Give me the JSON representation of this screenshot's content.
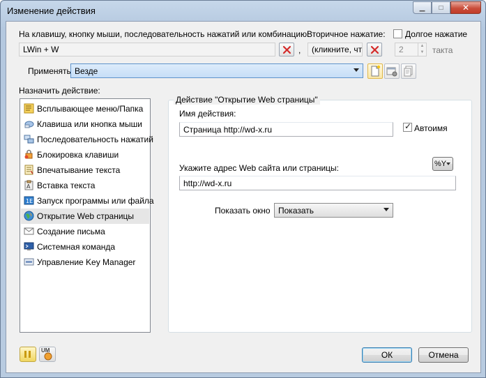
{
  "window": {
    "title": "Изменение действия",
    "minimize_glyph": "▁",
    "maximize_glyph": "□",
    "close_glyph": "✕"
  },
  "hotkey": {
    "label": "На клавишу, кнопку мыши, последовательность нажатий или комбинацию:",
    "value": "LWin + W",
    "comma": ",",
    "secondary_label": "Вторичное нажатие:",
    "secondary_value": "(кликните, что",
    "long_press_label": "Долгое нажатие",
    "long_press_checked": false,
    "ticks_value": "2",
    "ticks_label": "такта"
  },
  "apply": {
    "label": "Применять",
    "value": "Везде"
  },
  "assign": {
    "label": "Назначить действие:",
    "items": [
      {
        "label": "Всплывающее меню/Папка",
        "icon": "popup-menu-icon"
      },
      {
        "label": "Клавиша или кнопка мыши",
        "icon": "key-mouse-icon"
      },
      {
        "label": "Последовательность нажатий",
        "icon": "sequence-icon"
      },
      {
        "label": "Блокировка клавиши",
        "icon": "lock-key-icon"
      },
      {
        "label": "Впечатывание текста",
        "icon": "type-text-icon"
      },
      {
        "label": "Вставка текста",
        "icon": "paste-text-icon"
      },
      {
        "label": "Запуск программы или файла",
        "icon": "run-program-icon"
      },
      {
        "label": "Открытие Web страницы",
        "icon": "web-page-icon"
      },
      {
        "label": "Создание письма",
        "icon": "create-mail-icon"
      },
      {
        "label": "Системная команда",
        "icon": "system-command-icon"
      },
      {
        "label": "Управление Key Manager",
        "icon": "key-manager-icon"
      }
    ],
    "selected_index": 7
  },
  "detail": {
    "group_title": "Действие \"Открытие Web страницы\"",
    "name_label": "Имя действия:",
    "name_value": "Страница http://wd-x.ru",
    "autoname_label": "Автоимя",
    "autoname_checked": true,
    "url_label": "Укажите адрес Web сайта или страницы:",
    "url_value": "http://wd-x.ru",
    "macro_button": "%Y",
    "show_window_label": "Показать окно",
    "show_window_value": "Показать"
  },
  "buttons": {
    "ok": "ОК",
    "cancel": "Отмена",
    "um_badge": "UM"
  },
  "colors": {
    "titlebar": "#b8cbe0",
    "close": "#c94e3b",
    "apply_highlight": "#c6def7",
    "selected_row": "#e6e6e6"
  }
}
